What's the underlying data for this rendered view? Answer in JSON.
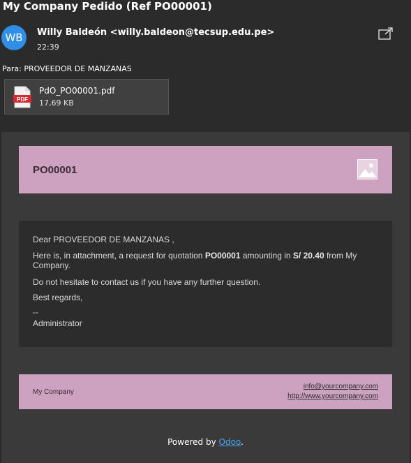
{
  "email": {
    "subject": "My Company Pedido (Ref PO00001)",
    "avatar_initials": "WB",
    "sender": "Willy Baldeón <willy.baldeon@tecsup.edu.pe>",
    "time": "22:39",
    "to_label": "Para:",
    "to": "PROVEEDOR DE MANZANAS",
    "attachment": {
      "name": "PdO_PO00001.pdf",
      "size": "17,69 KB",
      "icon_text": "PDF"
    }
  },
  "body": {
    "po_number": "PO00001",
    "greeting": "Dear PROVEEDOR DE MANZANAS ,",
    "line1_prefix": "Here is, in attachment, a request for quotation ",
    "line1_ref": "PO00001",
    "line1_mid": " amounting in ",
    "line1_amount": "S/ 20.40",
    "line1_suffix": " from My",
    "line1_cont": "Company.",
    "line2": "Do not hesitate to contact us if you have any further question.",
    "line3": "Best regards,",
    "signature_sep": "--",
    "signature": "Administrator"
  },
  "footer": {
    "company": "My Company",
    "email_link": "info@yourcompany.com",
    "web_link": "http://www.yourcompany.com",
    "powered_prefix": "Powered by ",
    "powered_link": "Odoo",
    "powered_suffix": "."
  },
  "colors": {
    "accent_band": "#cda2c1",
    "avatar": "#2f8ee8",
    "link": "#4aa3f0"
  }
}
